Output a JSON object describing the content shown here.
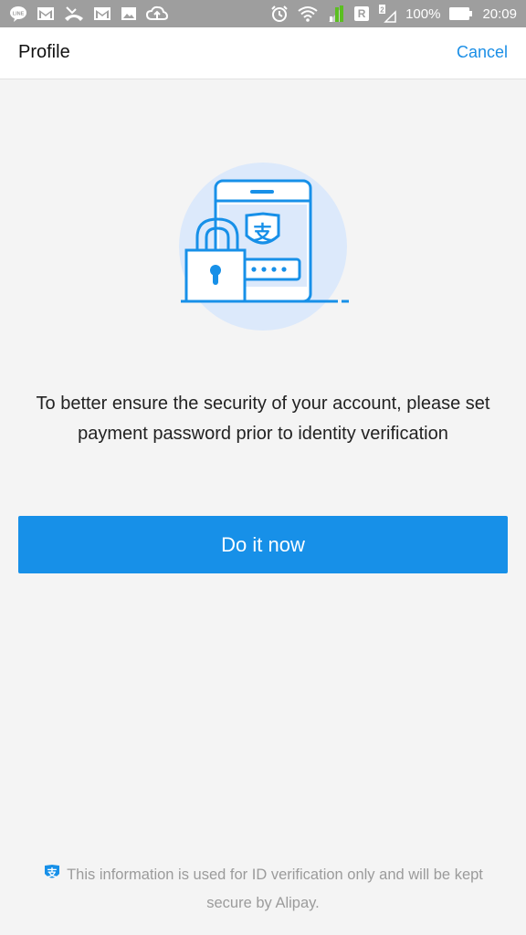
{
  "status_bar": {
    "battery_text": "100%",
    "time": "20:09",
    "roaming_badge": "R",
    "colors": {
      "bar": "#9e9e9e",
      "signal_accent": "#5bbf21"
    },
    "left_icons": [
      "line-app-icon",
      "gmail-icon",
      "missed-call-icon",
      "gmail-icon",
      "image-icon",
      "cloud-upload-icon"
    ],
    "right_icons": [
      "alarm-icon",
      "wifi-icon",
      "signal-icon",
      "roaming-badge",
      "sim2-signal-icon",
      "battery-icon"
    ]
  },
  "header": {
    "title": "Profile",
    "cancel_label": "Cancel"
  },
  "main": {
    "illustration_icon": "phone-lock-alipay-icon",
    "message": "To better ensure the security of your account, please set payment password prior to identity verification",
    "primary_button_label": "Do it now"
  },
  "footer": {
    "icon": "alipay-shield-icon",
    "text": "This information is used for ID verification only and will be kept secure by Alipay."
  },
  "colors": {
    "accent": "#1790e8",
    "link": "#1a8ee6",
    "background": "#f4f4f4",
    "illustration_circle": "#dce9fb"
  }
}
